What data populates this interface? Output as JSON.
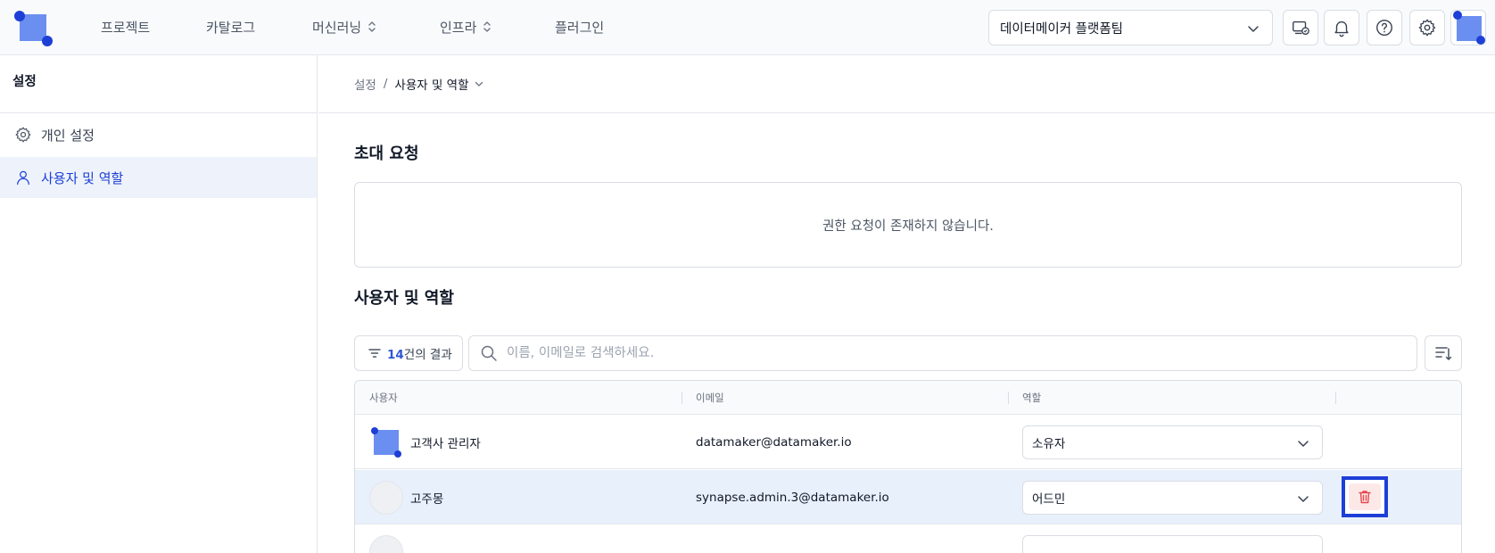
{
  "nav": {
    "items": [
      {
        "label": "프로젝트",
        "has_toggle": false
      },
      {
        "label": "카탈로그",
        "has_toggle": false
      },
      {
        "label": "머신러닝",
        "has_toggle": true
      },
      {
        "label": "인프라",
        "has_toggle": true
      },
      {
        "label": "플러그인",
        "has_toggle": false
      }
    ],
    "org_select": {
      "value": "데이터메이커 플랫폼팀"
    },
    "icons": [
      "monitor-sync-icon",
      "bell-icon",
      "help-icon",
      "gear-icon"
    ]
  },
  "sidebar": {
    "title": "설정",
    "items": [
      {
        "label": "개인 설정",
        "icon": "gear-icon",
        "active": false
      },
      {
        "label": "사용자 및 역할",
        "icon": "user-icon",
        "active": true
      }
    ]
  },
  "breadcrumb": {
    "root": "설정",
    "separator": "/",
    "current": "사용자 및 역할"
  },
  "invite": {
    "title": "초대 요청",
    "empty_message": "권한 요청이 존재하지 않습니다."
  },
  "users": {
    "title": "사용자 및 역할",
    "result_count": "14",
    "result_suffix": "건의 결과",
    "search_placeholder": "이름, 이메일로 검색하세요.",
    "columns": {
      "user": "사용자",
      "email": "이메일",
      "role": "역할"
    },
    "rows": [
      {
        "name": "고객사 관리자",
        "email": "datamaker@datamaker.io",
        "role": "소유자",
        "avatar": "logo",
        "highlighted": false
      },
      {
        "name": "고주몽",
        "email": "synapse.admin.3@datamaker.io",
        "role": "어드민",
        "avatar": "blank",
        "highlighted": true
      }
    ]
  },
  "colors": {
    "accent": "#1d3fd6",
    "highlight_row": "#e8f0fc",
    "delete_red": "#e5484d"
  }
}
